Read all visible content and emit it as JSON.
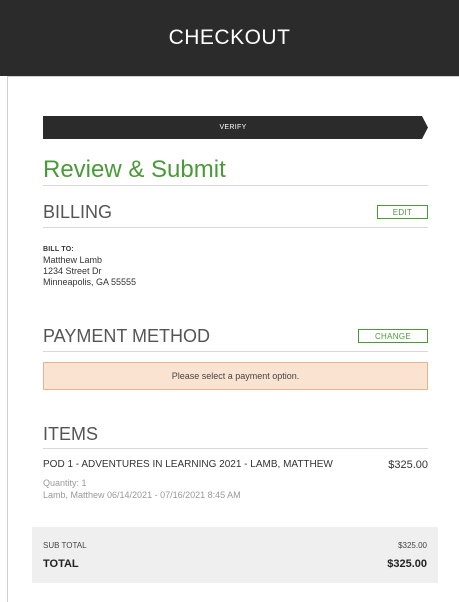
{
  "header": {
    "title": "CHECKOUT"
  },
  "progress": {
    "step_label": "VERIFY"
  },
  "page": {
    "title": "Review & Submit"
  },
  "billing": {
    "title": "BILLING",
    "edit_label": "EDIT",
    "bill_to_label": "BILL TO:",
    "name": "Matthew Lamb",
    "street": "1234 Street Dr",
    "city_line": "Minneapolis, GA 55555"
  },
  "payment": {
    "title": "PAYMENT METHOD",
    "change_label": "CHANGE",
    "alert_text": "Please select a payment option."
  },
  "items": {
    "title": "ITEMS",
    "list": [
      {
        "name": "POD 1 - ADVENTURES IN LEARNING 2021 - LAMB, MATTHEW",
        "price": "$325.00",
        "quantity": "Quantity: 1",
        "details": "Lamb, Matthew 06/14/2021 - 07/16/2021 8:45 AM"
      }
    ]
  },
  "summary": {
    "subtotal_label": "SUB TOTAL",
    "subtotal_value": "$325.00",
    "total_label": "TOTAL",
    "total_value": "$325.00"
  },
  "colors": {
    "header_bg": "#2b2b2b",
    "accent_green": "#4a9a3a",
    "alert_bg": "#fbe3d2",
    "alert_border": "#e8b48f",
    "summary_bg": "#efefef"
  }
}
